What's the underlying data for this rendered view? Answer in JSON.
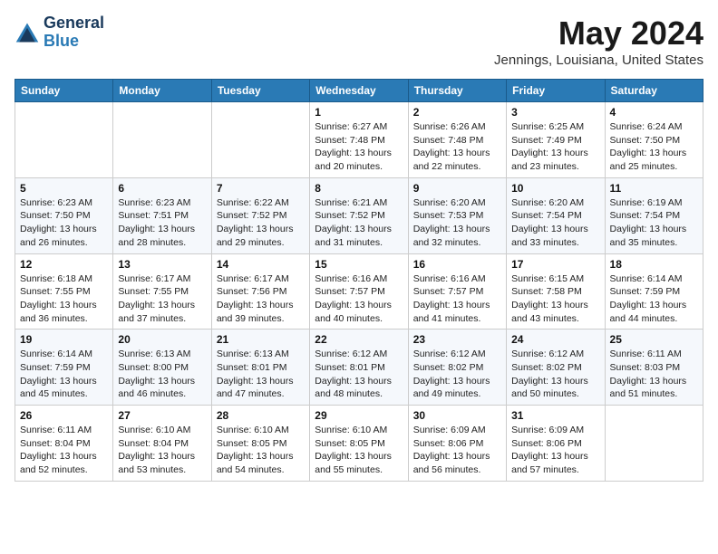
{
  "header": {
    "logo_line1": "General",
    "logo_line2": "Blue",
    "month_title": "May 2024",
    "location": "Jennings, Louisiana, United States"
  },
  "days_of_week": [
    "Sunday",
    "Monday",
    "Tuesday",
    "Wednesday",
    "Thursday",
    "Friday",
    "Saturday"
  ],
  "weeks": [
    [
      {
        "day": "",
        "sunrise": "",
        "sunset": "",
        "daylight": ""
      },
      {
        "day": "",
        "sunrise": "",
        "sunset": "",
        "daylight": ""
      },
      {
        "day": "",
        "sunrise": "",
        "sunset": "",
        "daylight": ""
      },
      {
        "day": "1",
        "sunrise": "Sunrise: 6:27 AM",
        "sunset": "Sunset: 7:48 PM",
        "daylight": "Daylight: 13 hours and 20 minutes."
      },
      {
        "day": "2",
        "sunrise": "Sunrise: 6:26 AM",
        "sunset": "Sunset: 7:48 PM",
        "daylight": "Daylight: 13 hours and 22 minutes."
      },
      {
        "day": "3",
        "sunrise": "Sunrise: 6:25 AM",
        "sunset": "Sunset: 7:49 PM",
        "daylight": "Daylight: 13 hours and 23 minutes."
      },
      {
        "day": "4",
        "sunrise": "Sunrise: 6:24 AM",
        "sunset": "Sunset: 7:50 PM",
        "daylight": "Daylight: 13 hours and 25 minutes."
      }
    ],
    [
      {
        "day": "5",
        "sunrise": "Sunrise: 6:23 AM",
        "sunset": "Sunset: 7:50 PM",
        "daylight": "Daylight: 13 hours and 26 minutes."
      },
      {
        "day": "6",
        "sunrise": "Sunrise: 6:23 AM",
        "sunset": "Sunset: 7:51 PM",
        "daylight": "Daylight: 13 hours and 28 minutes."
      },
      {
        "day": "7",
        "sunrise": "Sunrise: 6:22 AM",
        "sunset": "Sunset: 7:52 PM",
        "daylight": "Daylight: 13 hours and 29 minutes."
      },
      {
        "day": "8",
        "sunrise": "Sunrise: 6:21 AM",
        "sunset": "Sunset: 7:52 PM",
        "daylight": "Daylight: 13 hours and 31 minutes."
      },
      {
        "day": "9",
        "sunrise": "Sunrise: 6:20 AM",
        "sunset": "Sunset: 7:53 PM",
        "daylight": "Daylight: 13 hours and 32 minutes."
      },
      {
        "day": "10",
        "sunrise": "Sunrise: 6:20 AM",
        "sunset": "Sunset: 7:54 PM",
        "daylight": "Daylight: 13 hours and 33 minutes."
      },
      {
        "day": "11",
        "sunrise": "Sunrise: 6:19 AM",
        "sunset": "Sunset: 7:54 PM",
        "daylight": "Daylight: 13 hours and 35 minutes."
      }
    ],
    [
      {
        "day": "12",
        "sunrise": "Sunrise: 6:18 AM",
        "sunset": "Sunset: 7:55 PM",
        "daylight": "Daylight: 13 hours and 36 minutes."
      },
      {
        "day": "13",
        "sunrise": "Sunrise: 6:17 AM",
        "sunset": "Sunset: 7:55 PM",
        "daylight": "Daylight: 13 hours and 37 minutes."
      },
      {
        "day": "14",
        "sunrise": "Sunrise: 6:17 AM",
        "sunset": "Sunset: 7:56 PM",
        "daylight": "Daylight: 13 hours and 39 minutes."
      },
      {
        "day": "15",
        "sunrise": "Sunrise: 6:16 AM",
        "sunset": "Sunset: 7:57 PM",
        "daylight": "Daylight: 13 hours and 40 minutes."
      },
      {
        "day": "16",
        "sunrise": "Sunrise: 6:16 AM",
        "sunset": "Sunset: 7:57 PM",
        "daylight": "Daylight: 13 hours and 41 minutes."
      },
      {
        "day": "17",
        "sunrise": "Sunrise: 6:15 AM",
        "sunset": "Sunset: 7:58 PM",
        "daylight": "Daylight: 13 hours and 43 minutes."
      },
      {
        "day": "18",
        "sunrise": "Sunrise: 6:14 AM",
        "sunset": "Sunset: 7:59 PM",
        "daylight": "Daylight: 13 hours and 44 minutes."
      }
    ],
    [
      {
        "day": "19",
        "sunrise": "Sunrise: 6:14 AM",
        "sunset": "Sunset: 7:59 PM",
        "daylight": "Daylight: 13 hours and 45 minutes."
      },
      {
        "day": "20",
        "sunrise": "Sunrise: 6:13 AM",
        "sunset": "Sunset: 8:00 PM",
        "daylight": "Daylight: 13 hours and 46 minutes."
      },
      {
        "day": "21",
        "sunrise": "Sunrise: 6:13 AM",
        "sunset": "Sunset: 8:01 PM",
        "daylight": "Daylight: 13 hours and 47 minutes."
      },
      {
        "day": "22",
        "sunrise": "Sunrise: 6:12 AM",
        "sunset": "Sunset: 8:01 PM",
        "daylight": "Daylight: 13 hours and 48 minutes."
      },
      {
        "day": "23",
        "sunrise": "Sunrise: 6:12 AM",
        "sunset": "Sunset: 8:02 PM",
        "daylight": "Daylight: 13 hours and 49 minutes."
      },
      {
        "day": "24",
        "sunrise": "Sunrise: 6:12 AM",
        "sunset": "Sunset: 8:02 PM",
        "daylight": "Daylight: 13 hours and 50 minutes."
      },
      {
        "day": "25",
        "sunrise": "Sunrise: 6:11 AM",
        "sunset": "Sunset: 8:03 PM",
        "daylight": "Daylight: 13 hours and 51 minutes."
      }
    ],
    [
      {
        "day": "26",
        "sunrise": "Sunrise: 6:11 AM",
        "sunset": "Sunset: 8:04 PM",
        "daylight": "Daylight: 13 hours and 52 minutes."
      },
      {
        "day": "27",
        "sunrise": "Sunrise: 6:10 AM",
        "sunset": "Sunset: 8:04 PM",
        "daylight": "Daylight: 13 hours and 53 minutes."
      },
      {
        "day": "28",
        "sunrise": "Sunrise: 6:10 AM",
        "sunset": "Sunset: 8:05 PM",
        "daylight": "Daylight: 13 hours and 54 minutes."
      },
      {
        "day": "29",
        "sunrise": "Sunrise: 6:10 AM",
        "sunset": "Sunset: 8:05 PM",
        "daylight": "Daylight: 13 hours and 55 minutes."
      },
      {
        "day": "30",
        "sunrise": "Sunrise: 6:09 AM",
        "sunset": "Sunset: 8:06 PM",
        "daylight": "Daylight: 13 hours and 56 minutes."
      },
      {
        "day": "31",
        "sunrise": "Sunrise: 6:09 AM",
        "sunset": "Sunset: 8:06 PM",
        "daylight": "Daylight: 13 hours and 57 minutes."
      },
      {
        "day": "",
        "sunrise": "",
        "sunset": "",
        "daylight": ""
      }
    ]
  ]
}
